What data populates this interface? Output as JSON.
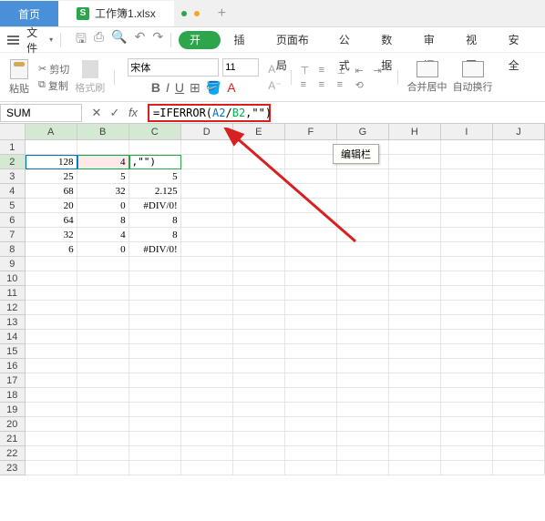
{
  "tabs": {
    "home": "首页",
    "fileTab": "工作簿1.xlsx",
    "sIcon": "S",
    "addTab": "+"
  },
  "menu": {
    "file": "文件",
    "start": "开始",
    "insert": "插入",
    "pageLayout": "页面布局",
    "formula": "公式",
    "data": "数据",
    "review": "审阅",
    "view": "视图",
    "security": "安全"
  },
  "ribbon": {
    "paste": "粘贴",
    "cut": "剪切",
    "copy": "复制",
    "formatPainter": "格式刷",
    "fontName": "宋体",
    "fontSize": "11",
    "mergeCenter": "合并居中",
    "wrapText": "自动换行"
  },
  "formulaBar": {
    "nameBox": "SUM",
    "formulaPrefix": "=IFERROR(",
    "argA2": "A2",
    "slash": "/",
    "argB2": "B2",
    "formulaSuffix": ",\"\")",
    "tooltip": "编辑栏"
  },
  "cols": [
    "A",
    "B",
    "C",
    "D",
    "E",
    "F",
    "G",
    "H",
    "I",
    "J"
  ],
  "rows": [
    "1",
    "2",
    "3",
    "4",
    "5",
    "6",
    "7",
    "8",
    "9",
    "10",
    "11",
    "12",
    "13",
    "14",
    "15",
    "16",
    "17",
    "18",
    "19",
    "20",
    "21",
    "22",
    "23"
  ],
  "cells": {
    "A2": "128",
    "B2": "4",
    "C2": ",\"\")",
    "A3": "25",
    "B3": "5",
    "C3": "5",
    "A4": "68",
    "B4": "32",
    "C4": "2.125",
    "A5": "20",
    "B5": "0",
    "C5": "#DIV/0!",
    "A6": "64",
    "B6": "8",
    "C6": "8",
    "A7": "32",
    "B7": "4",
    "C7": "8",
    "A8": "6",
    "B8": "0",
    "C8": "#DIV/0!"
  }
}
